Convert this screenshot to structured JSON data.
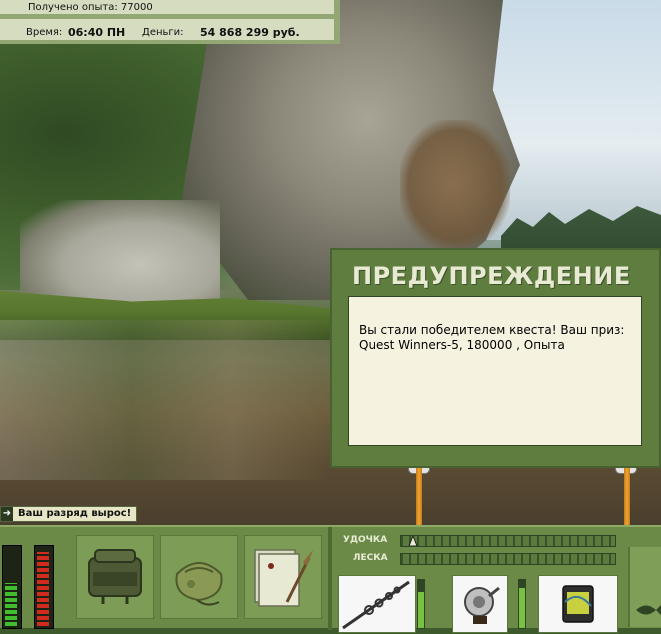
{
  "top_bar": {
    "experience": "Получено опыта: 77000",
    "time_label": "Время:",
    "time_value": "06:40 ПН",
    "money_label": "Деньги:",
    "money_value": "54 868 299 руб."
  },
  "dialog": {
    "title": "ПРЕДУПРЕЖДЕНИЕ",
    "message": "Вы стали победителем квеста! Ваш приз: Quest Winners-5, 180000 , Опыта"
  },
  "notification": {
    "rank_text": "Ваш разряд вырос!"
  },
  "tackle_panel": {
    "rod_label": "УДОЧКА",
    "line_label": "ЛЕСКА"
  },
  "meters": {
    "left_green_level": 0.55,
    "left_red_level": 0.95
  },
  "colors": {
    "panel_green": "#6b8a48",
    "dialog_green": "#5f7d3f",
    "paper": "#f5f3e0",
    "meter_green": "#3fbf2e",
    "meter_red": "#d22a1e"
  },
  "icons": [
    "tackle-box-icon",
    "bait-bag-icon",
    "notebook-icon",
    "fishing-rod-icon",
    "reel-icon",
    "line-spool-icon",
    "fish-icon"
  ]
}
